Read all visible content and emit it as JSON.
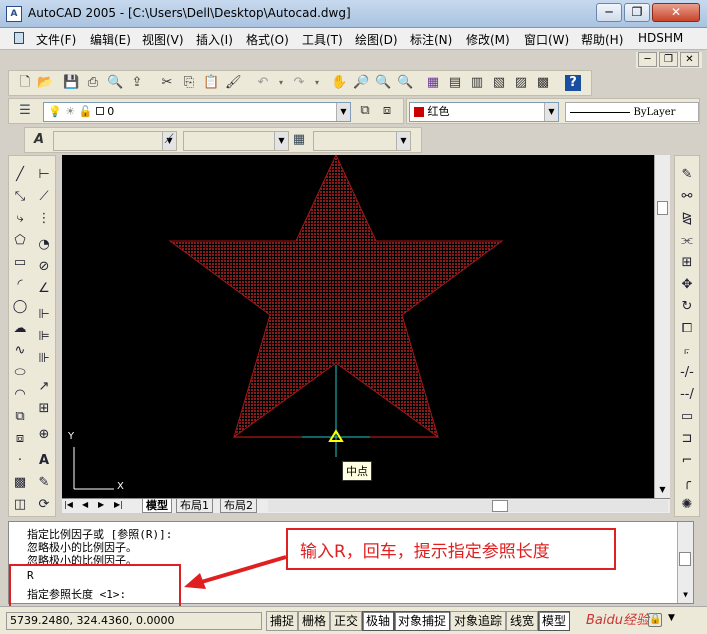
{
  "window": {
    "app_icon": "A",
    "title": "AutoCAD 2005 - [C:\\Users\\Dell\\Desktop\\Autocad.dwg]",
    "minimize": "─",
    "restore": "❐",
    "close": "✕",
    "doc_minimize": "─",
    "doc_restore": "❐",
    "doc_close": "✕"
  },
  "menu": [
    "文件(F)",
    "编辑(E)",
    "视图(V)",
    "插入(I)",
    "格式(O)",
    "工具(T)",
    "绘图(D)",
    "标注(N)",
    "修改(M)",
    "窗口(W)",
    "帮助(H)",
    "HDSHM"
  ],
  "layers": {
    "current_layer": "0",
    "color": "红色",
    "linetype": "ByLayer",
    "color_swatch": "#cc0000"
  },
  "canvas": {
    "snap_tooltip": "中点",
    "ucs_x": "X",
    "ucs_y": "Y",
    "star_color": "#8b1a1a",
    "snap_marker_color": "#ffff00",
    "cursor_color": "#20c8c8"
  },
  "tabs": [
    "模型",
    "布局1",
    "布局2"
  ],
  "command_history": [
    "指定比例因子或 [参照(R)]:",
    "忽略极小的比例因子。",
    "忽略极小的比例因子。",
    "R",
    "指定参照长度 <1>:"
  ],
  "annotation": "输入R，回车，提示指定参照长度",
  "status": {
    "coords": "5739.2480, 324.4360, 0.0000",
    "buttons": [
      {
        "label": "捕捉",
        "on": false
      },
      {
        "label": "栅格",
        "on": false
      },
      {
        "label": "正交",
        "on": false
      },
      {
        "label": "极轴",
        "on": true
      },
      {
        "label": "对象捕捉",
        "on": true
      },
      {
        "label": "对象追踪",
        "on": false
      },
      {
        "label": "线宽",
        "on": false
      },
      {
        "label": "模型",
        "on": true
      }
    ]
  },
  "watermark": "Baidu经验"
}
